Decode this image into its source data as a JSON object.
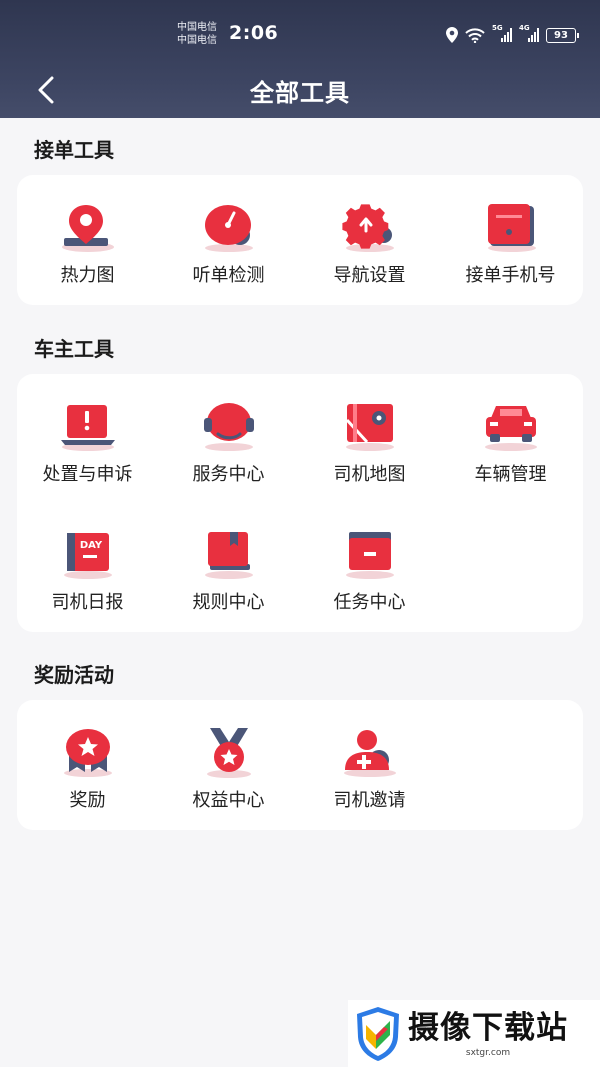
{
  "status_bar": {
    "carrier_1": "中国电信",
    "carrier_2": "中国电信",
    "time": "2:06",
    "signal_tag_1": "5G",
    "signal_tag_2": "4G",
    "battery": "93"
  },
  "header": {
    "title": "全部工具",
    "back_icon": "chevron-left-icon"
  },
  "sections": [
    {
      "title": "接单工具",
      "tools": [
        {
          "label": "热力图",
          "icon": "location-pin-icon"
        },
        {
          "label": "听单检测",
          "icon": "gauge-icon"
        },
        {
          "label": "导航设置",
          "icon": "gear-arrow-icon"
        },
        {
          "label": "接单手机号",
          "icon": "phone-box-icon"
        }
      ]
    },
    {
      "title": "车主工具",
      "tools": [
        {
          "label": "处置与申诉",
          "icon": "alert-laptop-icon"
        },
        {
          "label": "服务中心",
          "icon": "headset-icon"
        },
        {
          "label": "司机地图",
          "icon": "map-icon"
        },
        {
          "label": "车辆管理",
          "icon": "car-icon"
        },
        {
          "label": "司机日报",
          "icon": "day-calendar-icon",
          "icon_text": "DAY"
        },
        {
          "label": "规则中心",
          "icon": "rule-book-icon"
        },
        {
          "label": "任务中心",
          "icon": "task-folder-icon"
        }
      ]
    },
    {
      "title": "奖励活动",
      "tools": [
        {
          "label": "奖励",
          "icon": "star-ribbon-icon"
        },
        {
          "label": "权益中心",
          "icon": "star-medal-icon"
        },
        {
          "label": "司机邀请",
          "icon": "user-plus-icon"
        }
      ]
    }
  ],
  "watermark": {
    "title": "摄像下载站",
    "url": "sxtgr.com"
  },
  "colors": {
    "header": "#3d4562",
    "accent_red": "#e8303f",
    "accent_navy": "#4b5678"
  }
}
